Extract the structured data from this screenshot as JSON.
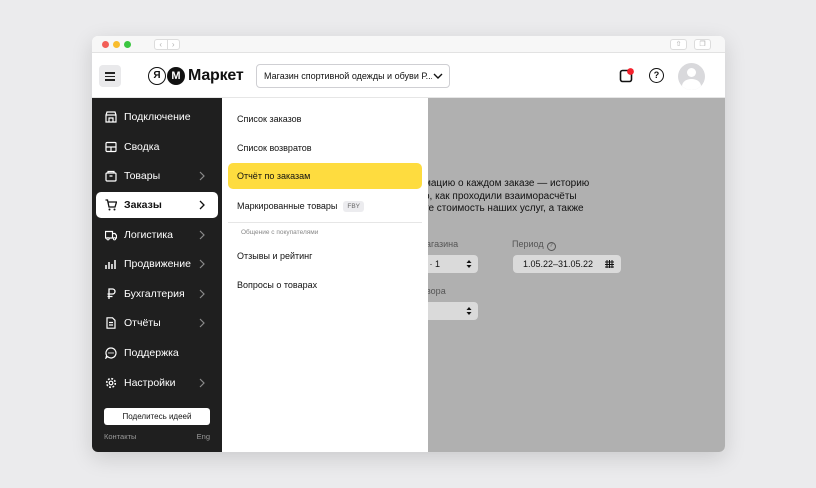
{
  "browser": {
    "back_glyph": "‹",
    "forward_glyph": "›",
    "share_glyph": "⇧",
    "tabs_glyph": "❐"
  },
  "header": {
    "logo_letter_ya": "Я",
    "logo_letter_m": "M",
    "logo_text": "Маркет",
    "store_select_value": "Магазин спортивной одежды и обуви Р...",
    "help_glyph": "?",
    "icons": [
      "menu-icon",
      "chevron-down-icon",
      "notification-icon",
      "help-icon",
      "avatar-icon"
    ],
    "notification_dot_color": "#f5222d"
  },
  "sidebar": {
    "items": [
      {
        "label": "Подключение",
        "icon": "store-icon",
        "has_arrow": false
      },
      {
        "label": "Сводка",
        "icon": "dashboard-icon",
        "has_arrow": false
      },
      {
        "label": "Товары",
        "icon": "box-icon",
        "has_arrow": true
      },
      {
        "label": "Заказы",
        "icon": "cart-icon",
        "has_arrow": true,
        "active": true
      },
      {
        "label": "Логистика",
        "icon": "truck-icon",
        "has_arrow": true
      },
      {
        "label": "Продвижение",
        "icon": "chart-icon",
        "has_arrow": true
      },
      {
        "label": "Бухгалтерия",
        "icon": "ruble-icon",
        "has_arrow": true
      },
      {
        "label": "Отчёты",
        "icon": "document-icon",
        "has_arrow": true
      },
      {
        "label": "Поддержка",
        "icon": "chat-icon",
        "has_arrow": false
      },
      {
        "label": "Настройки",
        "icon": "gear-icon",
        "has_arrow": true
      }
    ],
    "share_button": "Поделитесь идеей",
    "contacts": "Контакты",
    "lang": "Eng"
  },
  "submenu": {
    "items": [
      {
        "label": "Список заказов"
      },
      {
        "label": "Список возвратов"
      },
      {
        "label": "Отчёт по заказам",
        "active": true
      },
      {
        "label": "Маркированные товары",
        "badge": "FBY"
      }
    ],
    "section_heading": "Общение с покупателями",
    "section_items": [
      {
        "label": "Отзывы и рейтинг"
      },
      {
        "label": "Вопросы о товарах"
      }
    ]
  },
  "main": {
    "description_lines": [
      "мацию о каждом заказе — историю",
      "о, как проходили взаиморасчёты",
      "те стоимость наших услуг, а также"
    ],
    "store_field_label": "агазина",
    "store_field_value": "р · 1",
    "period_label": "Период",
    "period_help_glyph": "?",
    "period_value": "1.05.22–31.05.22",
    "product_field_label": "вора",
    "accent_color": "#fedc3f",
    "overlay_color": "#b0b0b0"
  }
}
